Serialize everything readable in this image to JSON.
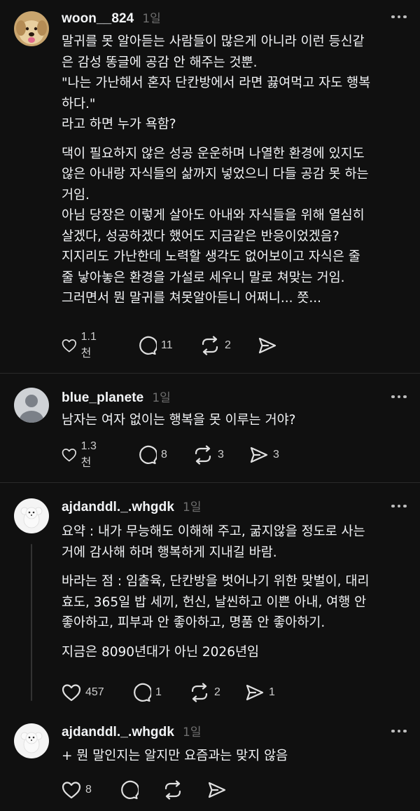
{
  "posts": [
    {
      "username": "woon__824",
      "time": "1일",
      "paragraphs": [
        [
          "말귀를 못 알아듣는 사람들이 많은게 아니라 이런 등신같",
          "은 감성 똥글에 공감 안 해주는 것뿐.",
          "\"나는 가난해서 혼자 단칸방에서 라면 끓여먹고 자도 행복",
          "하다.\"",
          "라고 하면 누가 욕함?"
        ],
        [
          "댁이 필요하지 않은 성공 운운하며 나열한 환경에 있지도",
          "않은 아내랑 자식들의 삶까지 넣었으니 다들 공감 못 하는",
          "거임.",
          "아님 당장은 이렇게 살아도 아내와 자식들을 위해 열심히",
          "살겠다, 성공하겠다 했어도 지금같은 반응이었겠음?",
          "지지리도 가난한데 노력할 생각도 없어보이고 자식은 줄",
          "줄 낳아놓은 환경을 가설로 세우니 말로 쳐맞는 거임.",
          "그러면서 뭔 말귀를 쳐못알아듣니 어쩌니... 쯧..."
        ]
      ],
      "likes": "1.1천",
      "comments": "11",
      "reposts": "2",
      "shares": ""
    },
    {
      "username": "blue_planete",
      "time": "1일",
      "paragraphs": [
        [
          "남자는 여자 없이는 행복을 못 이루는 거야?"
        ]
      ],
      "likes": "1.3천",
      "comments": "8",
      "reposts": "3",
      "shares": "3"
    },
    {
      "username": "ajdanddl._.whgdk",
      "time": "1일",
      "paragraphs": [
        [
          "요약 : 내가 무능해도 이해해 주고, 굶지않을 정도로 사는",
          "거에 감사해 하며 행복하게 지내길 바람."
        ],
        [
          "바라는 점 : 임출육, 단칸방을 벗어나기 위한 맞벌이, 대리",
          "효도, 365일 밥 세끼, 헌신, 날씬하고 이쁜 아내, 여행 안",
          "좋아하고, 피부과 안 좋아하고, 명품 안 좋아하기."
        ],
        [
          "지금은 8090년대가 아닌 2026년임"
        ]
      ],
      "likes": "457",
      "comments": "1",
      "reposts": "2",
      "shares": "1"
    },
    {
      "username": "ajdanddl._.whgdk",
      "time": "1일",
      "paragraphs": [
        [
          "+ 뭔 말인지는 알지만 요즘과는 맞지 않음"
        ]
      ],
      "likes": "8",
      "comments": "",
      "reposts": "",
      "shares": ""
    }
  ]
}
